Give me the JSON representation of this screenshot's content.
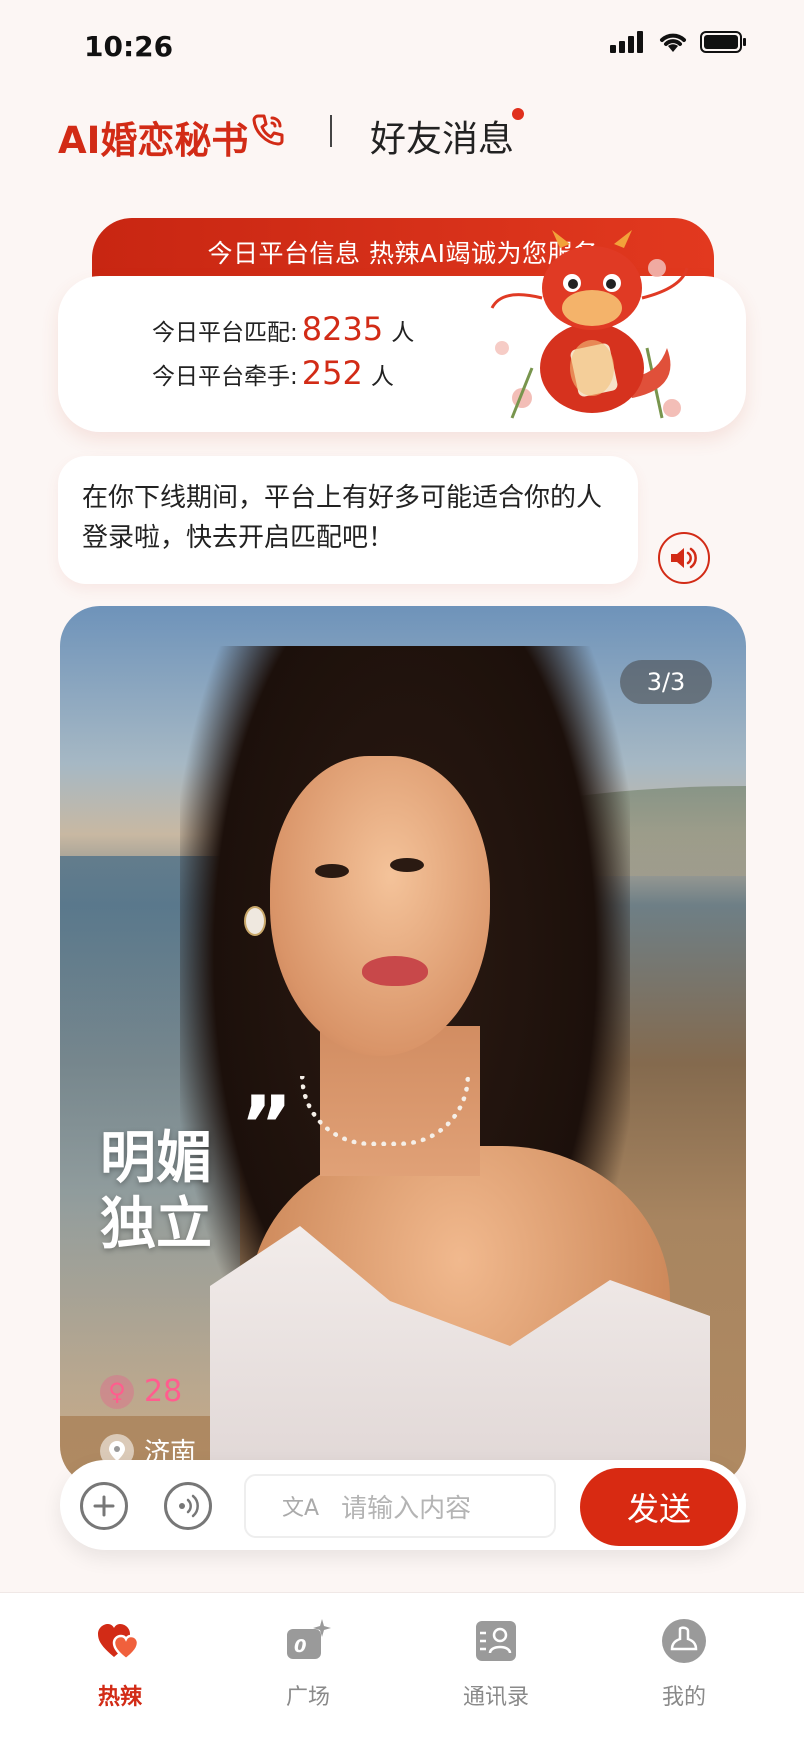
{
  "status_bar": {
    "time": "10:26"
  },
  "header": {
    "title": "AI婚恋秘书",
    "friends_tab": "好友消息"
  },
  "banner": {
    "text": "今日平台信息 热辣AI竭诚为您服务"
  },
  "stats": {
    "match_label": "今日平台匹配:",
    "match_value": "8235",
    "match_unit": "人",
    "hand_label": "今日平台牵手:",
    "hand_value": "252",
    "hand_unit": "人"
  },
  "message": {
    "text": "在你下线期间，平台上有好多可能适合你的人登录啦，快去开启匹配吧！"
  },
  "profile": {
    "counter": "3/3",
    "tagline_line1": "明媚",
    "tagline_line2": "独立",
    "quote": "”",
    "age": "28",
    "location": "济南"
  },
  "input_bar": {
    "placeholder": "请输入内容",
    "send_label": "发送"
  },
  "tabs": [
    {
      "label": "热辣",
      "icon": "hearts-icon",
      "active": true
    },
    {
      "label": "广场",
      "icon": "camera-sparkle-icon",
      "active": false
    },
    {
      "label": "通讯录",
      "icon": "contacts-icon",
      "active": false
    },
    {
      "label": "我的",
      "icon": "profile-icon",
      "active": false
    }
  ],
  "colors": {
    "accent": "#d22b16",
    "background": "#fcf6f4",
    "gender_pink": "#ff5d8e"
  }
}
